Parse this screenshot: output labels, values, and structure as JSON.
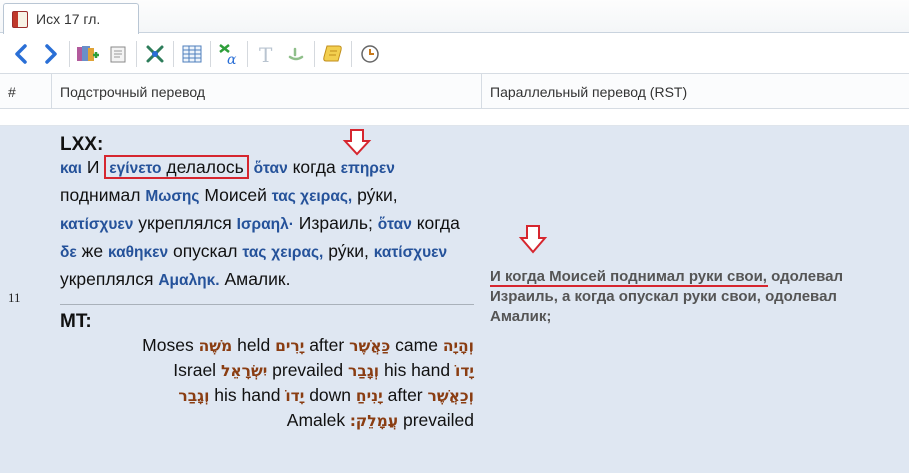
{
  "tab": {
    "title": "Исх 17 гл."
  },
  "toolbar": {
    "icons": [
      "back-arrow-icon",
      "forward-arrow-icon",
      "add-bookmark-icon",
      "document-icon",
      "tools-icon",
      "table-icon",
      "strong-alpha-icon",
      "text-format-icon",
      "hebrew-letter-icon",
      "scroll-icon",
      "clock-icon"
    ]
  },
  "columns": {
    "num": "#",
    "interlinear": "Подстрочный перевод",
    "parallel": "Параллельный перевод (RST)"
  },
  "row": {
    "num": "11",
    "lxx_label": "LXX:",
    "lxx": [
      {
        "g": "και"
      },
      {
        "r": "И"
      },
      {
        "g": "εγίνετο",
        "hl": true,
        "r2": "делалось"
      },
      {
        "g": "ὅταν"
      },
      {
        "r": "когда"
      },
      {
        "g": "επηρεν"
      },
      {
        "r": "поднимал"
      },
      {
        "g": "Μωσης"
      },
      {
        "r": "Моисей"
      },
      {
        "g": "τας χειρας,"
      },
      {
        "r": "ру́ки,"
      },
      {
        "g": "κατίσχυεν"
      },
      {
        "r": "укреплялся"
      },
      {
        "g": "Ισραηλ·"
      },
      {
        "r": "Израиль;"
      },
      {
        "g": "ὅταν"
      },
      {
        "r": "когда"
      },
      {
        "g": "δε"
      },
      {
        "r": "же"
      },
      {
        "g": "καθηκεν"
      },
      {
        "r": "опускал"
      },
      {
        "g": "τας"
      },
      {
        "g": "χειρας,"
      },
      {
        "r": "ру́ки,"
      },
      {
        "g": "κατίσχυεν"
      },
      {
        "r": "укреплялся"
      },
      {
        "g": "Αμαληκ."
      },
      {
        "r": "Амалик."
      }
    ],
    "mt_label": "MT:",
    "mt_lines": [
      [
        {
          "h": "וְהָיָה"
        },
        {
          "e": "came"
        },
        {
          "h": "כַּאֲשֶׁר"
        },
        {
          "e": "after"
        },
        {
          "h": "יָרִים"
        },
        {
          "e": "held"
        },
        {
          "h": "מֹשֶׁה"
        },
        {
          "e": "Moses"
        }
      ],
      [
        {
          "h": "יָדוֹ"
        },
        {
          "e": "his hand"
        },
        {
          "h": "וְגָבַר"
        },
        {
          "e": "prevailed"
        },
        {
          "h": "יִשְׂרָאֵל"
        },
        {
          "e": "Israel"
        }
      ],
      [
        {
          "h": "וְכַאֲשֶׁר"
        },
        {
          "e": "after"
        },
        {
          "h": "יָנִיחַ"
        },
        {
          "e": "down"
        },
        {
          "h": "יָדוֹ"
        },
        {
          "e": "his hand"
        },
        {
          "h": "וְגָבַר"
        }
      ],
      [
        {
          "e": "prevailed"
        },
        {
          "h": "עֲמָלֵק׃"
        },
        {
          "e": "Amalek"
        }
      ]
    ],
    "parallel": "И когда Моисей поднимал руки свои, одолевал Израиль, а когда опускал руки свои, одолевал Амалик;"
  },
  "colors": {
    "greek": "#25529a",
    "hebrew": "#8a3d12",
    "highlight": "#d6262f",
    "row_bg": "#dfe7f2"
  }
}
